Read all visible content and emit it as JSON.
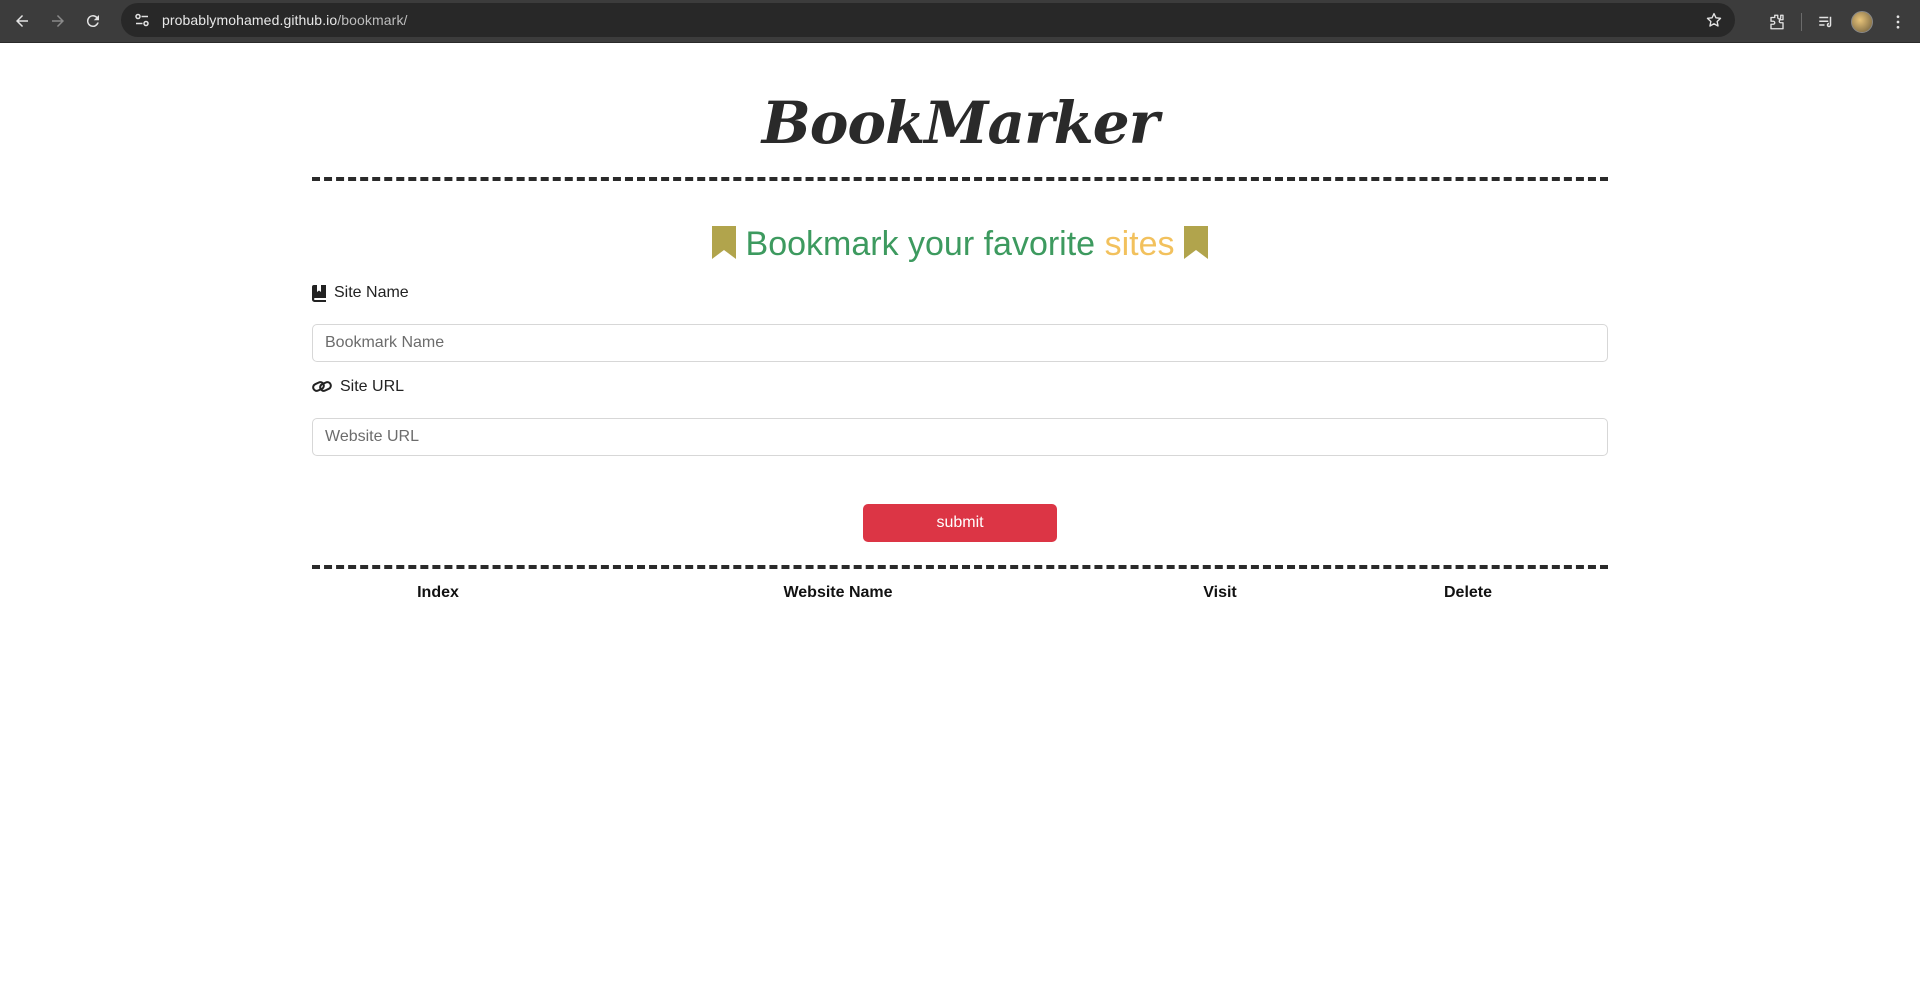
{
  "browser": {
    "url_host": "probablymohamed.github.io",
    "url_path": "/bookmark/",
    "icons": [
      "back-icon",
      "forward-icon",
      "reload-icon",
      "site-info-icon",
      "bookmark-star-icon",
      "extensions-icon",
      "tab-search-icon",
      "profile-avatar",
      "kebab-menu-icon"
    ]
  },
  "app": {
    "logo": "BookMarker",
    "heading_main": "Bookmark your favorite",
    "heading_accent": "sites",
    "colors": {
      "heading": "#3d9a5f",
      "accent": "#f2c15d",
      "bookmark_icon": "#b1a44c",
      "submit": "#dc3545"
    }
  },
  "form": {
    "site_name_label": "Site Name",
    "site_name_placeholder": "Bookmark Name",
    "site_name_value": "",
    "site_url_label": "Site URL",
    "site_url_placeholder": "Website URL",
    "site_url_value": "",
    "submit_label": "submit"
  },
  "table": {
    "headers": [
      "Index",
      "Website Name",
      "Visit",
      "Delete"
    ],
    "rows": []
  }
}
